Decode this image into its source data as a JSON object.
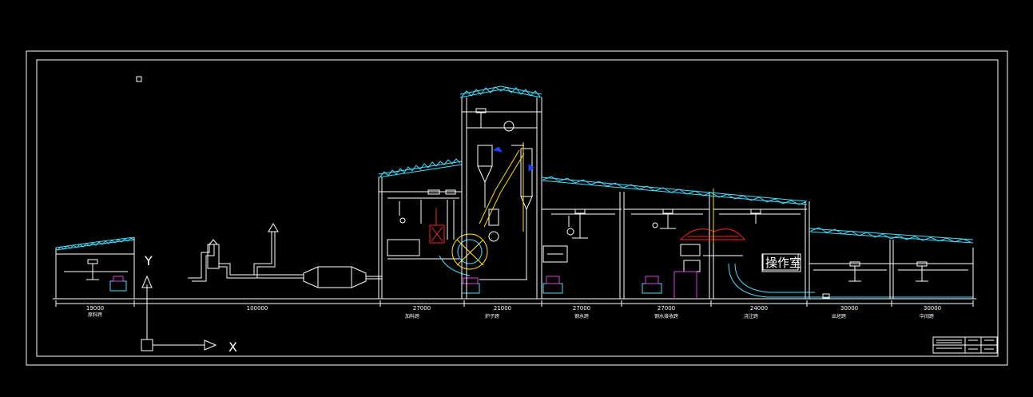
{
  "drawing": {
    "background": "#000000",
    "colors": {
      "frame": "#ffffff",
      "roof_truss": "#40e0ff",
      "equipment_red": "#ff2020",
      "equipment_blue": "#2040ff",
      "equipment_magenta": "#e040e0",
      "equipment_yellow": "#ffe000",
      "equipment_cyan": "#40e0ff"
    },
    "operator_room_label": "操作室",
    "axis_y_label": "Y",
    "axis_x_label": "X",
    "spans": [
      {
        "dimension": "19000",
        "bay_name": "原料跨"
      },
      {
        "dimension": "100000",
        "bay_name": ""
      },
      {
        "dimension": "27000",
        "bay_name": "加料跨"
      },
      {
        "dimension": "21000",
        "bay_name": "炉子跨"
      },
      {
        "dimension": "27000",
        "bay_name": "钢水跨"
      },
      {
        "dimension": "27000",
        "bay_name": "钢水接收跨"
      },
      {
        "dimension": "24000",
        "bay_name": "浇注跨"
      },
      {
        "dimension": "30000",
        "bay_name": "出坯跨"
      },
      {
        "dimension": "30000",
        "bay_name": "中间跨"
      }
    ]
  }
}
